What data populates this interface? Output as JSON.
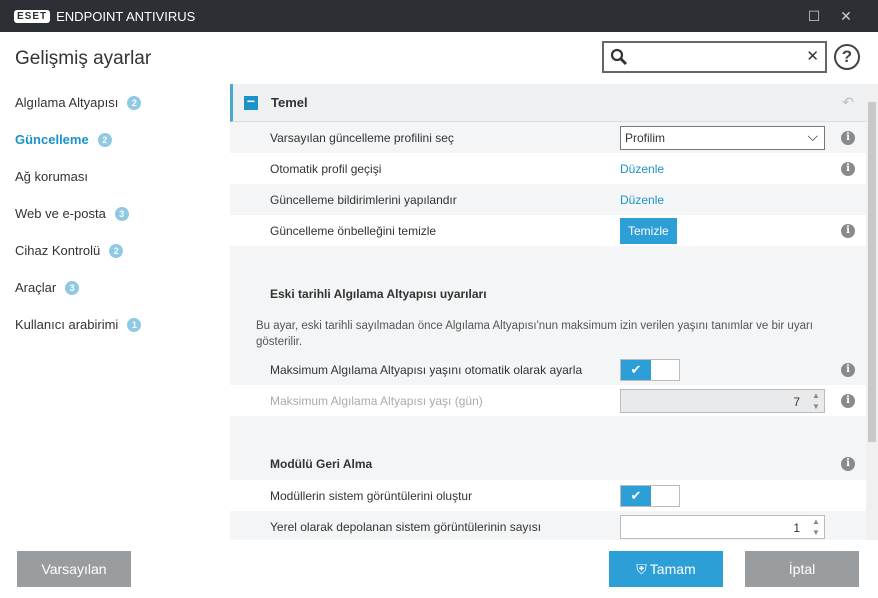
{
  "titlebar": {
    "logo": "ESET",
    "title": "ENDPOINT ANTIVIRUS"
  },
  "header": {
    "title": "Gelişmiş ayarlar",
    "search_placeholder": ""
  },
  "sidebar": {
    "items": [
      {
        "label": "Algılama Altyapısı",
        "badge": "2"
      },
      {
        "label": "Güncelleme",
        "badge": "2"
      },
      {
        "label": "Ağ koruması",
        "badge": ""
      },
      {
        "label": "Web ve e-posta",
        "badge": "3"
      },
      {
        "label": "Cihaz Kontrolü",
        "badge": "2"
      },
      {
        "label": "Araçlar",
        "badge": "3"
      },
      {
        "label": "Kullanıcı arabirimi",
        "badge": "1"
      }
    ]
  },
  "main": {
    "section_title": "Temel",
    "rows": {
      "profile_label": "Varsayılan güncelleme profilini seç",
      "profile_value": "Profilim",
      "auto_switch_label": "Otomatik profil geçişi",
      "auto_switch_link": "Düzenle",
      "notify_label": "Güncelleme bildirimlerini yapılandır",
      "notify_link": "Düzenle",
      "cache_label": "Güncelleme önbelleğini temizle",
      "cache_button": "Temizle"
    },
    "outdated": {
      "title": "Eski tarihli Algılama Altyapısı uyarıları",
      "description": "Bu ayar, eski tarihli sayılmadan önce Algılama Altyapısı'nun maksimum izin verilen yaşını tanımlar ve bir uyarı gösterilir.",
      "auto_age_label": "Maksimum Algılama Altyapısı yaşını otomatik olarak ayarla",
      "age_label": "Maksimum Algılama Altyapısı yaşı (gün)",
      "age_value": "7"
    },
    "rollback": {
      "title": "Modülü Geri Alma",
      "snapshots_label": "Modüllerin sistem görüntülerini oluştur",
      "count_label": "Yerel olarak depolanan sistem görüntülerinin sayısı",
      "count_value": "1"
    }
  },
  "footer": {
    "default_button": "Varsayılan",
    "ok_button": "Tamam",
    "cancel_button": "İptal"
  },
  "colors": {
    "accent": "#2b9fd6",
    "titlebar": "#2c2f33",
    "link": "#1a93c7"
  }
}
